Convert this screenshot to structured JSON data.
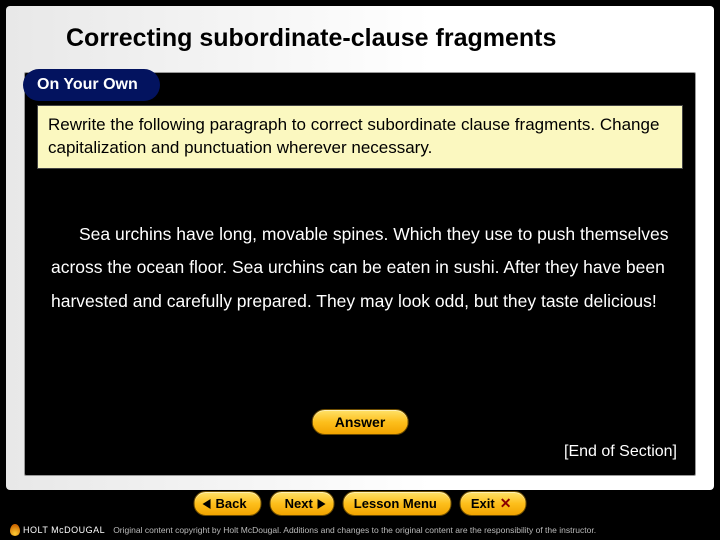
{
  "title": "Correcting subordinate-clause fragments",
  "badge": "On Your Own",
  "instruction": "Rewrite the following paragraph to correct subordinate clause fragments. Change capitalization and punctuation wherever necessary.",
  "paragraph": "Sea urchins have long, movable spines. Which they use to push themselves across the ocean floor. Sea urchins can be eaten in sushi. After they have been harvested and carefully prepared. They may look odd, but they taste delicious!",
  "answer_label": "Answer",
  "end_section": "[End of Section]",
  "nav": {
    "back": "Back",
    "next": "Next",
    "lesson_menu": "Lesson Menu",
    "exit": "Exit"
  },
  "publisher": "HOLT McDOUGAL",
  "copyright": "Original content copyright by Holt McDougal. Additions and changes to the original content are the responsibility of the instructor."
}
